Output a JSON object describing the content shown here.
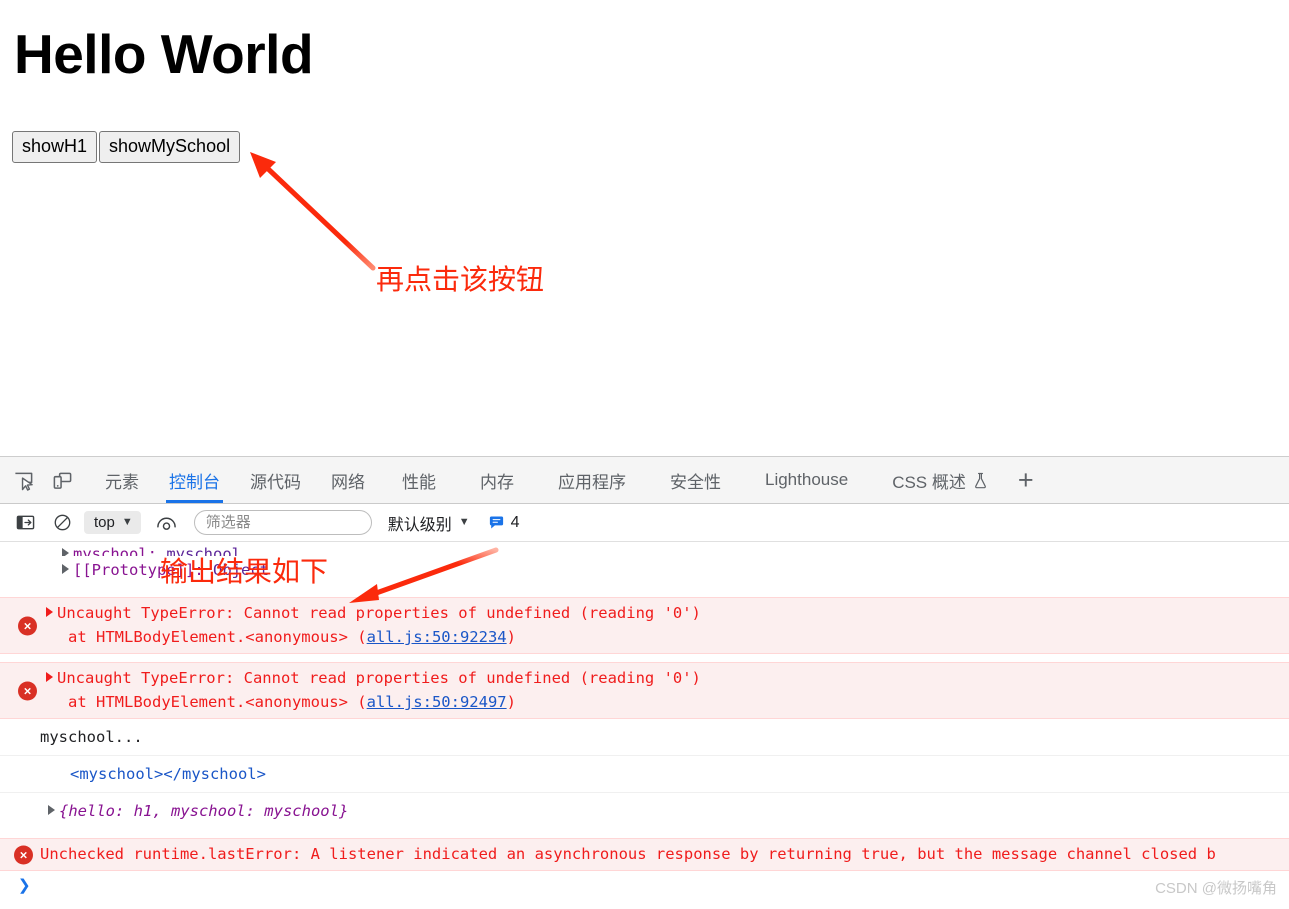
{
  "page": {
    "heading": "Hello World",
    "buttons": [
      {
        "label": "showH1",
        "name": "show-h1-button"
      },
      {
        "label": "showMySchool",
        "name": "show-myschool-button"
      }
    ]
  },
  "annotations": [
    {
      "text": "再点击该按钮",
      "color": "#fb2a0c"
    },
    {
      "text": "输出结果如下",
      "color": "#fb2a0c"
    }
  ],
  "devtools": {
    "toolbar_icons": [
      {
        "name": "inspect-element-icon"
      },
      {
        "name": "device-toolbar-icon"
      }
    ],
    "tabs": [
      {
        "label": "元素",
        "selected": false
      },
      {
        "label": "控制台",
        "selected": true
      },
      {
        "label": "源代码",
        "selected": false
      },
      {
        "label": "网络",
        "selected": false
      },
      {
        "label": "性能",
        "selected": false
      },
      {
        "label": "内存",
        "selected": false
      },
      {
        "label": "应用程序",
        "selected": false
      },
      {
        "label": "安全性",
        "selected": false
      },
      {
        "label": "Lighthouse",
        "selected": false
      },
      {
        "label": "CSS 概述",
        "selected": false
      }
    ],
    "add_tab_label": "+",
    "console_toolbar": {
      "sidebar_icon": "console-sidebar-icon",
      "clear_icon": "clear-console-icon",
      "context": "top",
      "eye_icon": "live-expression-icon",
      "filter_placeholder": "筛选器",
      "filter_value": "",
      "level": "默认级别",
      "issues_count": "4",
      "issues_icon": "issues-bubble-icon"
    },
    "messages": [
      {
        "type": "object-prop",
        "indent": 1,
        "key": "myschool:",
        "value": "myschool",
        "clipped": true
      },
      {
        "type": "object-prop",
        "indent": 1,
        "key": "[[Prototype]]:",
        "value": "Object"
      },
      {
        "type": "error",
        "text": "Uncaught TypeError: Cannot read properties of undefined (reading '0')",
        "stack_prefix": "at HTMLBodyElement.<anonymous> (",
        "stack_link": "all.js:50:92234",
        "stack_suffix": ")"
      },
      {
        "type": "error",
        "text": "Uncaught TypeError: Cannot read properties of undefined (reading '0')",
        "stack_prefix": "at HTMLBodyElement.<anonymous> (",
        "stack_link": "all.js:50:92497",
        "stack_suffix": ")"
      },
      {
        "type": "log",
        "text": "myschool..."
      },
      {
        "type": "element",
        "text": "<myschool></myschool>"
      },
      {
        "type": "object",
        "text": "{hello: h1, myschool: myschool}"
      },
      {
        "type": "error",
        "text": "Unchecked runtime.lastError: A listener indicated an asynchronous response by returning true, but the message channel closed b"
      }
    ],
    "prompt": "❯"
  },
  "watermark": "CSDN @微扬嘴角"
}
